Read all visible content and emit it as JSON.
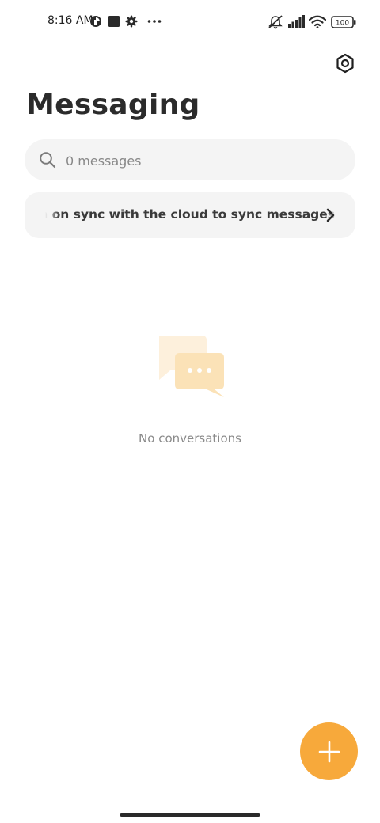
{
  "status_bar": {
    "time": "8:16 AM",
    "battery_level": "100",
    "icons": [
      "clock-app-icon",
      "stop-square-icon",
      "gear-icon",
      "more-dots-icon",
      "muted-bell-icon",
      "signal-icon",
      "wifi-icon",
      "battery-icon"
    ]
  },
  "header": {
    "title": "Messaging",
    "settings_icon": "hexagon-settings-icon"
  },
  "search": {
    "placeholder": "0 messages",
    "icon": "search-icon"
  },
  "sync_banner": {
    "text": "Turn on sync with the cloud to sync messages",
    "icon": "chevron-right-icon"
  },
  "empty_state": {
    "icon": "chat-bubbles-icon",
    "text": "No conversations"
  },
  "fab": {
    "icon": "plus-icon",
    "color": "#f7a93b"
  },
  "colors": {
    "accent": "#f7a93b",
    "surface": "#f4f4f4",
    "illustration_light": "#fdf0dc",
    "illustration_dark": "#fbe2b7"
  }
}
